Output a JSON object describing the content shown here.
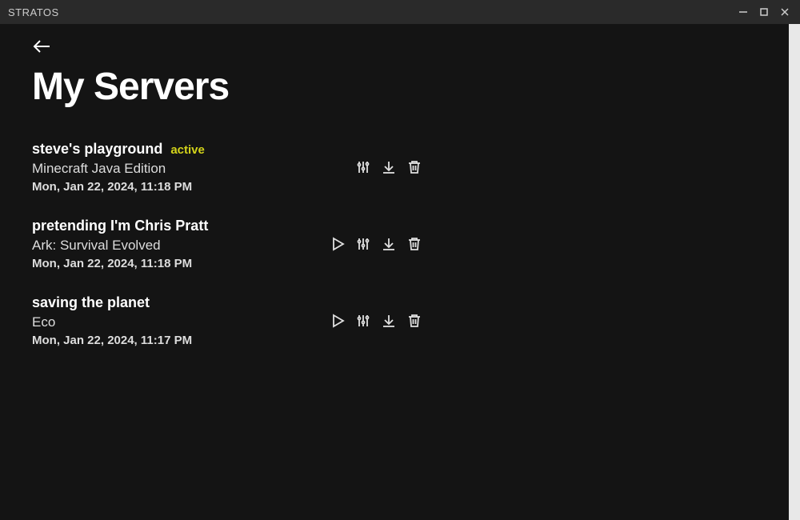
{
  "window": {
    "title": "STRATOS"
  },
  "page": {
    "title": "My Servers"
  },
  "servers": [
    {
      "name": "steve's playground",
      "status": "active",
      "game": "Minecraft Java Edition",
      "date": "Mon, Jan 22, 2024, 11:18 PM",
      "show_play": false
    },
    {
      "name": "pretending I'm Chris Pratt",
      "status": "",
      "game": "Ark: Survival Evolved",
      "date": "Mon, Jan 22, 2024, 11:18 PM",
      "show_play": true
    },
    {
      "name": "saving the planet",
      "status": "",
      "game": "Eco",
      "date": "Mon, Jan 22, 2024, 11:17 PM",
      "show_play": true
    }
  ],
  "colors": {
    "active_status": "#d4d41a",
    "background": "#141414",
    "titlebar": "#2a2a2a"
  }
}
